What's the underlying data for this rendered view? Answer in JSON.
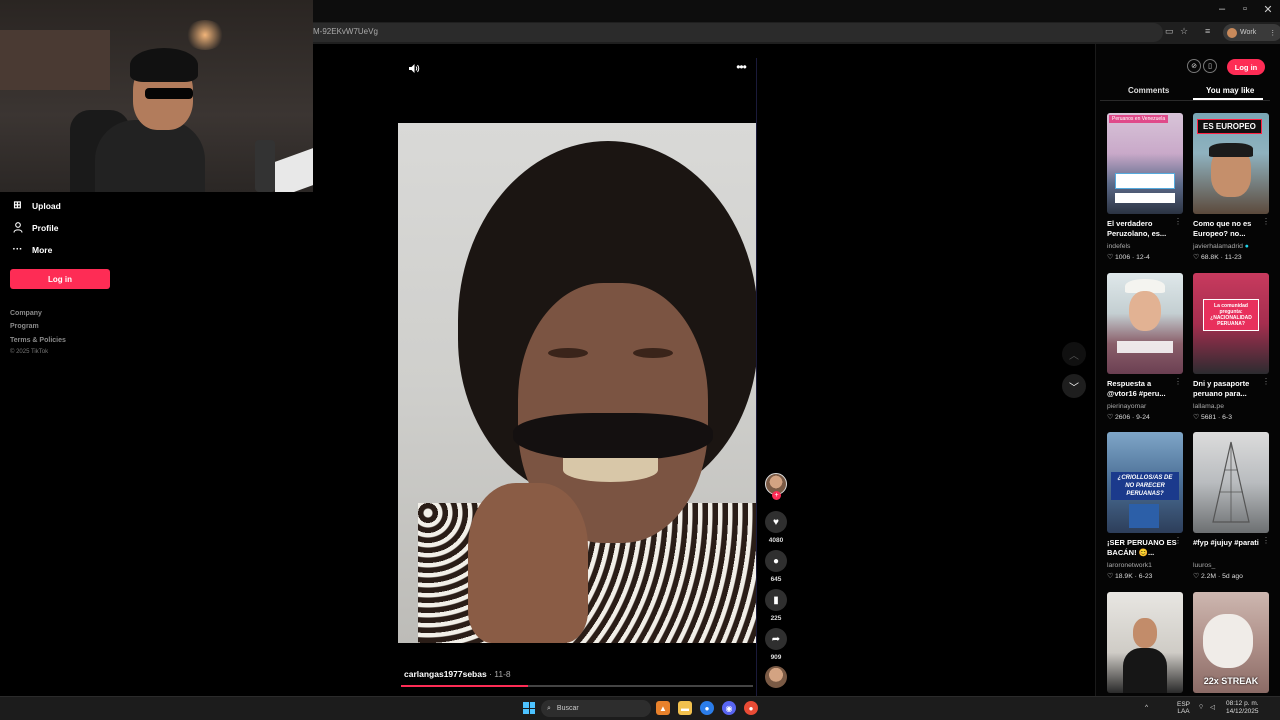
{
  "browser": {
    "url_fragment": "M-92EKvW7UeVg",
    "profile_label": "Work"
  },
  "sidebar": {
    "items": [
      {
        "label": "Upload",
        "icon": "upload-icon"
      },
      {
        "label": "Profile",
        "icon": "profile-icon"
      },
      {
        "label": "More",
        "icon": "more-icon"
      }
    ],
    "login_label": "Log in",
    "footer": [
      "Company",
      "Program",
      "Terms & Policies"
    ],
    "copyright": "© 2025 TikTok"
  },
  "video": {
    "author": "carlangas1977sebas",
    "date": "11-8",
    "progress_fraction": 0.36,
    "actions": {
      "likes": "4080",
      "comments": "645",
      "saves": "225",
      "shares": "909"
    }
  },
  "right_panel": {
    "login_label": "Log in",
    "tabs": [
      "Comments",
      "You may like"
    ],
    "cards": [
      {
        "title": "El verdadero Peruzolano, es...",
        "author": "indefels",
        "likes": "1006",
        "date": "12-4",
        "thumb_text": "Peruanos en Venezuela",
        "verified": false
      },
      {
        "title": "Como que no es Europeo? no...",
        "author": "javierhalamadrid",
        "likes": "68.8K",
        "date": "11-23",
        "thumb_text": "ES EUROPEO",
        "verified": true
      },
      {
        "title": "Respuesta a @vtor16 #peru...",
        "author": "pierinayomar",
        "likes": "2606",
        "date": "9-24",
        "thumb_text": "",
        "verified": false
      },
      {
        "title": "Dni y pasaporte peruano para...",
        "author": "lallama.pe",
        "likes": "5681",
        "date": "6-3",
        "thumb_text": "La comunidad pregunta: ¿NACIONALIDAD PERUANA?",
        "verified": false
      },
      {
        "title": "¡SER PERUANO ES BACÁN! 😊...",
        "author": "laroronetwork1",
        "likes": "18.9K",
        "date": "6-23",
        "thumb_text": "¿CRIOLLOS/AS DE NO PARECER PERUANAS?",
        "verified": false
      },
      {
        "title": "#fyp #jujuy #parati",
        "author": "luuros_",
        "likes": "2.2M",
        "date": "5d ago",
        "thumb_text": "",
        "verified": false
      },
      {
        "title": "",
        "author": "",
        "likes": "",
        "date": "",
        "thumb_text": "",
        "verified": false
      },
      {
        "title": "",
        "author": "",
        "likes": "",
        "date": "",
        "thumb_text": "22x STREAK",
        "verified": false
      }
    ]
  },
  "taskbar": {
    "search_placeholder": "Buscar",
    "lang_top": "ESP",
    "lang_bottom": "LAA",
    "time": "08:12 p. m.",
    "date": "14/12/2025"
  },
  "colors": {
    "accent": "#fe2c55",
    "background": "#000000"
  }
}
